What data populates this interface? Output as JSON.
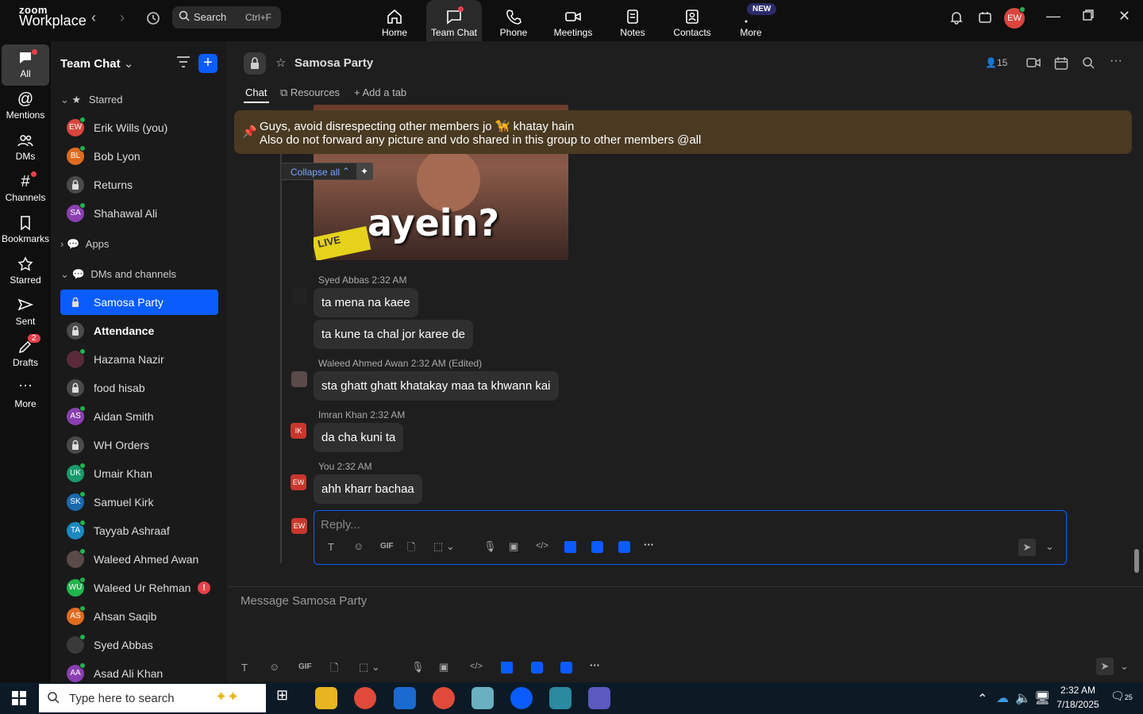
{
  "app": {
    "logo_top": "zoom",
    "logo_bottom": "Workplace"
  },
  "search": {
    "label": "Search",
    "shortcut": "Ctrl+F"
  },
  "topnav": [
    {
      "label": "Home"
    },
    {
      "label": "Team Chat"
    },
    {
      "label": "Phone"
    },
    {
      "label": "Meetings"
    },
    {
      "label": "Notes"
    },
    {
      "label": "Contacts"
    },
    {
      "label": "More"
    }
  ],
  "new_badge": "NEW",
  "user_initials": "EW",
  "rail": [
    {
      "label": "All"
    },
    {
      "label": "Mentions"
    },
    {
      "label": "DMs"
    },
    {
      "label": "Channels"
    },
    {
      "label": "Bookmarks"
    },
    {
      "label": "Starred"
    },
    {
      "label": "Sent"
    },
    {
      "label": "Drafts"
    },
    {
      "label": "More"
    }
  ],
  "drafts_count": "2",
  "sidebar": {
    "title": "Team Chat",
    "starred_label": "Starred",
    "apps_label": "Apps",
    "dms_label": "DMs and channels",
    "starred": [
      {
        "initials": "EW",
        "name": "Erik Wills (you)",
        "color": "#d9463e"
      },
      {
        "initials": "BL",
        "name": "Bob Lyon",
        "color": "#e06b1f"
      },
      {
        "initials": "",
        "name": "Returns",
        "color": "#4a4a4a"
      },
      {
        "initials": "SA",
        "name": "Shahawal Ali",
        "color": "#8b3fb0"
      }
    ],
    "items": [
      {
        "initials": "",
        "name": "Samosa Party",
        "color": "#0b5cff"
      },
      {
        "initials": "",
        "name": "Attendance",
        "color": "#4a4a4a"
      },
      {
        "initials": "",
        "name": "Hazama Nazir",
        "color": "#5a2a3a"
      },
      {
        "initials": "",
        "name": "food hisab",
        "color": "#4a4a4a"
      },
      {
        "initials": "AS",
        "name": "Aidan Smith",
        "color": "#8b3fb0"
      },
      {
        "initials": "",
        "name": "WH Orders",
        "color": "#4a4a4a"
      },
      {
        "initials": "UK",
        "name": "Umair Khan",
        "color": "#1a9a6a"
      },
      {
        "initials": "SK",
        "name": "Samuel Kirk",
        "color": "#1a6ab0"
      },
      {
        "initials": "TA",
        "name": "Tayyab Ashraaf",
        "color": "#1a8ac0"
      },
      {
        "initials": "",
        "name": "Waleed Ahmed Awan",
        "color": "#5a4a4a"
      },
      {
        "initials": "WU",
        "name": "Waleed Ur Rehman",
        "color": "#21b34c"
      },
      {
        "initials": "AS",
        "name": "Ahsan Saqib",
        "color": "#e06b1f"
      },
      {
        "initials": "",
        "name": "Syed Abbas",
        "color": "#3a3a3a"
      },
      {
        "initials": "AA",
        "name": "Asad Ali Khan",
        "color": "#8b3fb0"
      }
    ]
  },
  "channel": {
    "name": "Samosa Party",
    "members": "15",
    "tabs": [
      "Chat",
      "Resources",
      "Add a tab"
    ],
    "pinned_line1": "Guys, avoid disrespecting other members jo 🦮 khatay hain",
    "pinned_line2": "Also do not forward any picture and vdo shared in this group to other members @all",
    "collapse_label": "Collapse all",
    "image_caption": "ayein?",
    "image_tag": "LIVE"
  },
  "messages": [
    {
      "author": "Syed Abbas",
      "time": "2:32 AM",
      "edited": "",
      "lines": [
        "ta mena  na kaee",
        "ta kune ta chal jor karee de"
      ],
      "initials": ""
    },
    {
      "author": "Waleed Ahmed Awan",
      "time": "2:32 AM",
      "edited": "(Edited)",
      "lines": [
        "sta ghatt ghatt khatakay maa ta khwann kai"
      ],
      "initials": ""
    },
    {
      "author": "Imran Khan",
      "time": "2:32 AM",
      "edited": "",
      "lines": [
        "da cha kuni ta"
      ],
      "initials": "IK"
    },
    {
      "author": "You",
      "time": "2:32 AM",
      "edited": "",
      "lines": [
        "ahh kharr bachaa"
      ],
      "initials": "EW"
    }
  ],
  "reply": {
    "placeholder": "Reply...",
    "gif": "GIF"
  },
  "compose": {
    "placeholder": "Message Samosa Party",
    "gif": "GIF"
  },
  "taskbar": {
    "search": "Type here to search",
    "time": "2:32 AM",
    "date": "7/18/2025",
    "notif_count": "25"
  }
}
